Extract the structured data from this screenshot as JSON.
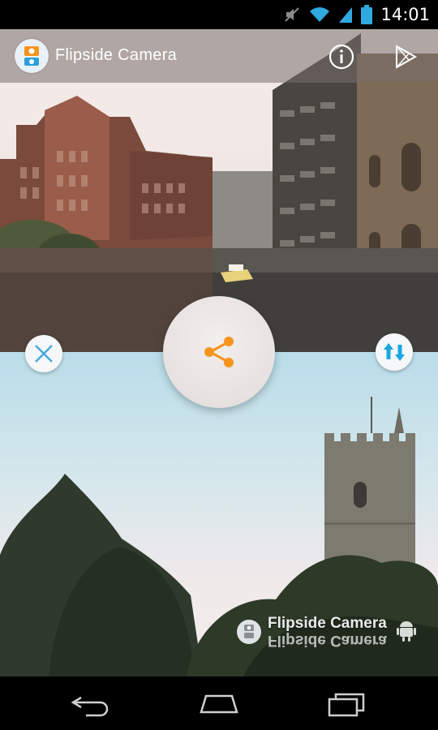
{
  "status_bar": {
    "time": "14:01",
    "icons": [
      "mute-icon",
      "wifi-icon",
      "signal-icon",
      "battery-icon"
    ]
  },
  "app_bar": {
    "title": "Flipside Camera",
    "icons": [
      "app-logo-icon",
      "info-icon",
      "play-store-icon"
    ]
  },
  "controls": {
    "close": "close-icon",
    "swap": "swap-vertical-icon",
    "share": "share-icon"
  },
  "watermark": {
    "text": "Flipside Camera",
    "reflection": "Flipside Camera"
  },
  "nav_bar": {
    "icons": [
      "back-icon",
      "home-icon",
      "recents-icon"
    ]
  },
  "colors": {
    "accent": "#f7941d",
    "swap_blue": "#1aa6e0",
    "close_blue": "#4aa9dd"
  }
}
